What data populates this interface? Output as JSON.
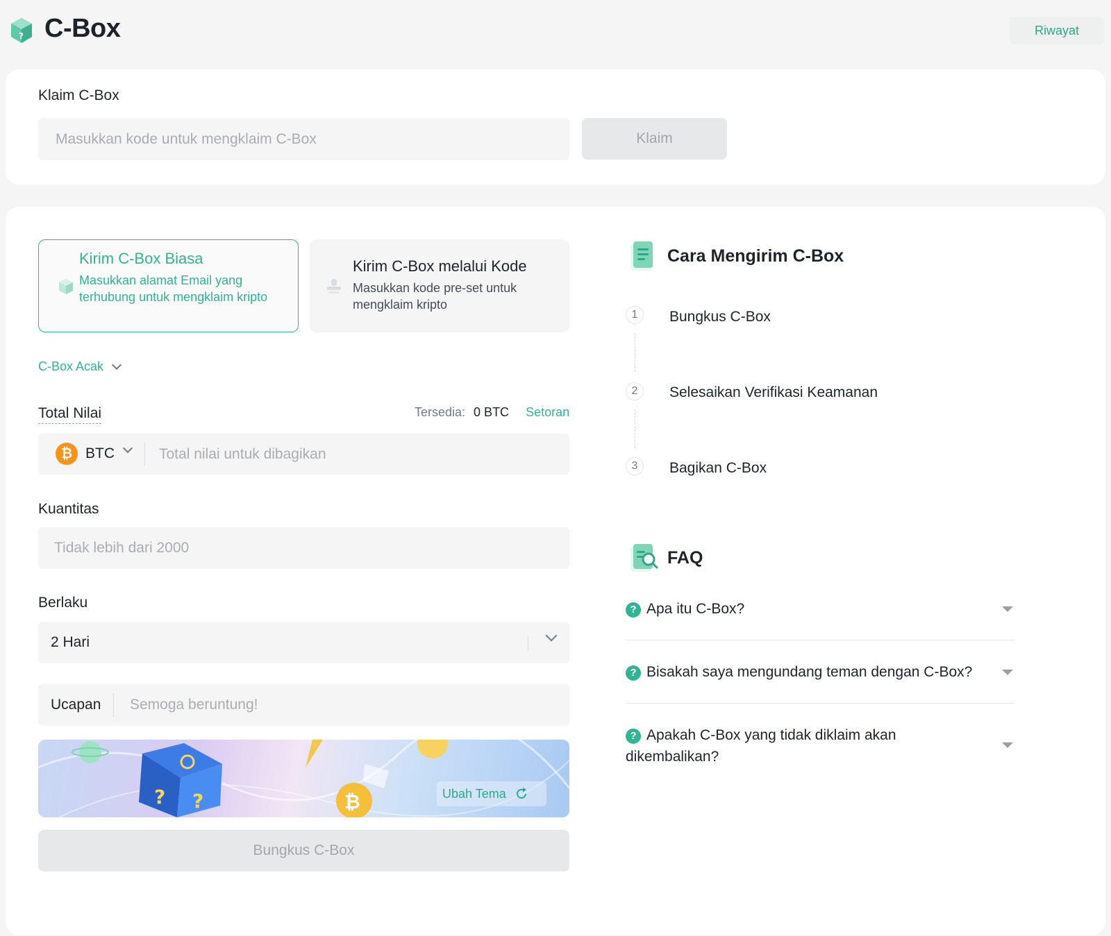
{
  "header": {
    "brand": "C-Box",
    "history_label": "Riwayat"
  },
  "claim": {
    "title": "Klaim C-Box",
    "input_placeholder": "Masukkan kode untuk mengklaim C-Box",
    "button_label": "Klaim"
  },
  "send_types": [
    {
      "title": "Kirim C-Box Biasa",
      "description": "Masukkan alamat Email yang terhubung untuk mengklaim kripto",
      "selected": true
    },
    {
      "title": "Kirim C-Box melalui Kode",
      "description": "Masukkan kode pre-set untuk mengklaim kripto",
      "selected": false
    }
  ],
  "box_type": {
    "selected": "C-Box Acak"
  },
  "total_value": {
    "label": "Total Nilai",
    "available_label": "Tersedia:",
    "available_amount": "0 BTC",
    "deposit_link": "Setoran",
    "coin": "BTC",
    "input_placeholder": "Total nilai untuk dibagikan"
  },
  "quantity": {
    "label": "Kuantitas",
    "input_placeholder": "Tidak lebih dari 2000"
  },
  "validity": {
    "label": "Berlaku",
    "selected": "2 Hari"
  },
  "greeting": {
    "label": "Ucapan",
    "input_placeholder": "Semoga beruntung!"
  },
  "theme": {
    "change_label": "Ubah Tema"
  },
  "wrap_button_label": "Bungkus C-Box",
  "how_to": {
    "title": "Cara Mengirim C-Box",
    "steps": [
      {
        "number": "1",
        "label": "Bungkus C-Box"
      },
      {
        "number": "2",
        "label": "Selesaikan Verifikasi Keamanan"
      },
      {
        "number": "3",
        "label": "Bagikan C-Box"
      }
    ]
  },
  "faq": {
    "title": "FAQ",
    "items": [
      {
        "question": "Apa itu C-Box?"
      },
      {
        "question": "Bisakah saya mengundang teman dengan C-Box?"
      },
      {
        "question": "Apakah C-Box yang tidak diklaim akan dikembalikan?"
      }
    ]
  },
  "colors": {
    "accent": "#2fb594",
    "accent_dark": "#2fa889",
    "btc": "#f7931a",
    "background": "#f5f5f5",
    "card": "#ffffff",
    "disabled_button": "#e7e8ea"
  },
  "icons": {
    "logo": "cbox-cube-icon",
    "normal_send": "cube-icon",
    "code_send": "stamp-icon",
    "how_to": "document-icon",
    "faq": "search-document-icon",
    "faq_question": "question-mark-icon",
    "refresh": "refresh-icon"
  }
}
